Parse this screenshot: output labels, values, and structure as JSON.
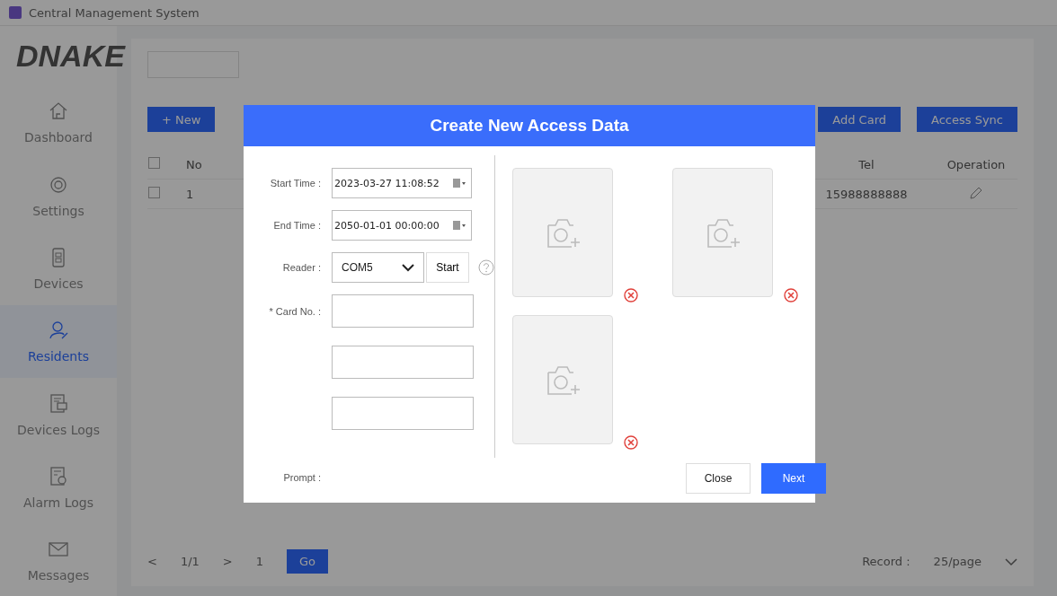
{
  "window": {
    "title": "Central Management System"
  },
  "logo": "DNAKE",
  "sidebar": {
    "items": [
      {
        "label": "Dashboard",
        "selected": false
      },
      {
        "label": "Settings",
        "selected": false
      },
      {
        "label": "Devices",
        "selected": false
      },
      {
        "label": "Residents",
        "selected": true
      },
      {
        "label": "Devices Logs",
        "selected": false
      },
      {
        "label": "Alarm Logs",
        "selected": false
      },
      {
        "label": "Messages",
        "selected": false
      }
    ]
  },
  "toolbar": {
    "new_button": "+ New",
    "right_buttons": [
      "Add Card",
      "Access Sync"
    ]
  },
  "table": {
    "columns": [
      "No",
      "Tel",
      "Operation"
    ],
    "header_checked": false,
    "rows": [
      {
        "no": "1",
        "tel": "15988888888",
        "checked": false
      }
    ]
  },
  "pagination": {
    "prev": "<",
    "pages": "1/1",
    "next": ">",
    "page": "1",
    "go": "Go",
    "record_label": "Record :",
    "per_page": "25/page"
  },
  "dialog": {
    "title": "Create New Access Data",
    "start_time": {
      "label": "Start Time :",
      "value": "2023-03-27  11:08:52"
    },
    "end_time": {
      "label": "End Time :",
      "value": "2050-01-01  00:00:00"
    },
    "reader": {
      "label": "Reader :",
      "value": "COM5",
      "start": "Start"
    },
    "card_no": {
      "label": "* Card No. :"
    },
    "card_fields": [
      {
        "kind": "field"
      },
      {
        "kind": "field"
      },
      {
        "kind": "field"
      }
    ],
    "prompt": {
      "label": "Prompt :"
    },
    "photos": [
      {
        "kind": "empty"
      },
      {
        "kind": "empty"
      },
      {
        "kind": "empty"
      }
    ],
    "buttons": [
      {
        "label": "Close",
        "kind": "secondary"
      },
      {
        "label": "Next",
        "kind": "primary"
      }
    ]
  }
}
